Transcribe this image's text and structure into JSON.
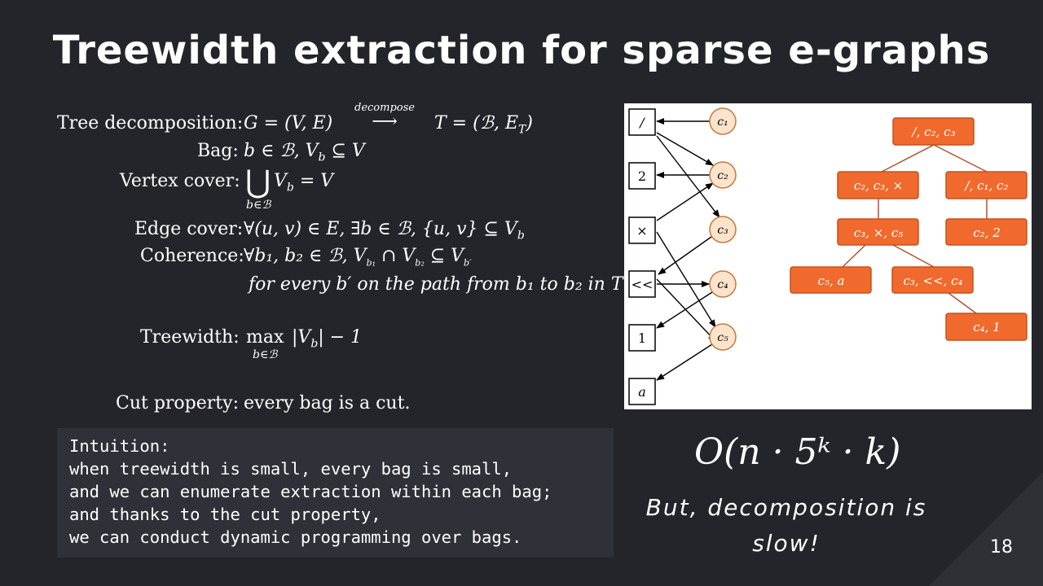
{
  "title": "Treewidth extraction for sparse e-graphs",
  "definitions": {
    "tree_decomposition": {
      "label": "Tree decomposition:",
      "expr_left": "G = (V, E)",
      "arrow_label": "decompose",
      "expr_right": "T = (ℬ, E",
      "expr_right_sub": "T",
      "expr_right_close": ")"
    },
    "bag": {
      "label": "Bag:",
      "expr": "b ∈ ℬ, V",
      "sub": "b",
      "expr2": " ⊆ V"
    },
    "vertex_cover": {
      "label": "Vertex cover:",
      "operator": "⋃",
      "under": "b∈ℬ",
      "expr": "V",
      "sub": "b",
      "expr2": " = V"
    },
    "edge_cover": {
      "label": "Edge cover:",
      "expr": "∀(u, v) ∈ E, ∃b ∈ ℬ, {u, v} ⊆ V",
      "sub": "b"
    },
    "coherence": {
      "label": "Coherence:",
      "expr": "∀b₁, b₂ ∈ ℬ, V",
      "sub1": "b₁",
      "mid": " ∩ V",
      "sub2": "b₂",
      "end": " ⊆ V",
      "sub3": "b′",
      "line2": "for every b′ on the path from b₁ to b₂ in T"
    },
    "treewidth": {
      "label": "Treewidth:",
      "operator": "max",
      "under": "b∈ℬ",
      "expr": "|V",
      "sub": "b",
      "expr2": "| − 1"
    },
    "cut_property": {
      "label": "Cut property:",
      "text": "every bag is a cut."
    }
  },
  "intuition": {
    "lines": [
      "Intuition:",
      "when treewidth is small, every bag is small,",
      "and we can enumerate extraction within each bag;",
      "and thanks to the cut property,",
      "we can conduct dynamic programming over bags."
    ]
  },
  "complexity": "O(n · 5ᵏ · k)",
  "note": "But, decomposition is slow!",
  "page_number": "18",
  "diagram": {
    "enodes": [
      "/",
      "2",
      "×",
      "<<",
      "1",
      "a"
    ],
    "eclasses": [
      "c₁",
      "c₂",
      "c₃",
      "c₄",
      "c₅"
    ],
    "bags": [
      "/, c₂, c₃",
      "c₂, c₃, ×",
      "/, c₁, c₂",
      "c₃, ×, c₅",
      "c₂, 2",
      "c₅, a",
      "c₃, <<, c₄",
      "c₄, 1"
    ],
    "colors": {
      "bag_fill": "#f06a2d",
      "bag_border": "#c4521c",
      "eclass_fill": "#fbe3cc",
      "eclass_border": "#c47a40",
      "edge": "#b5502a"
    }
  }
}
